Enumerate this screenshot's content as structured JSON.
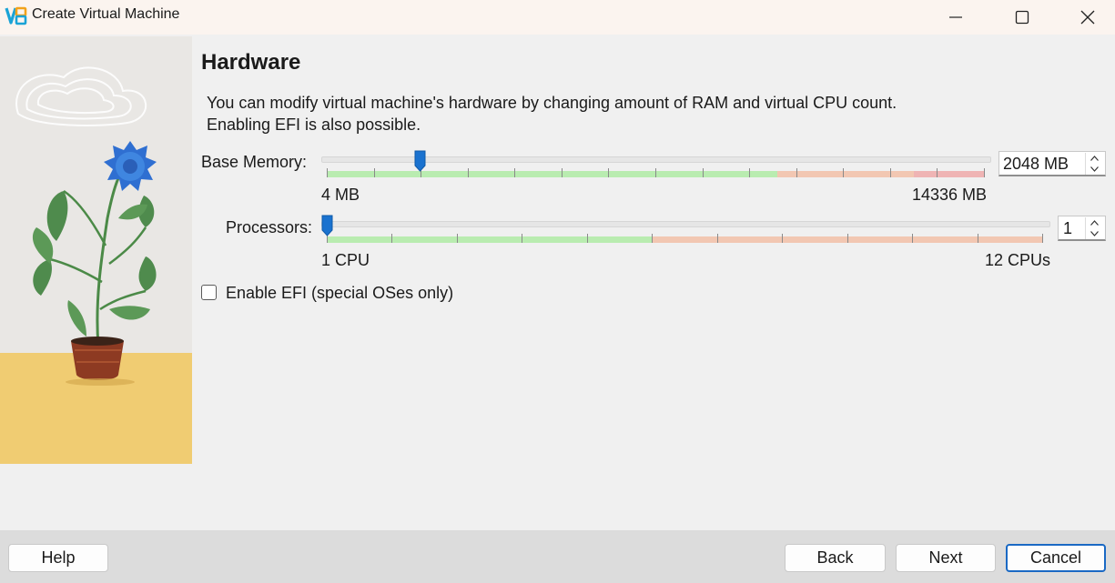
{
  "window": {
    "title": "Create Virtual Machine"
  },
  "page": {
    "heading": "Hardware",
    "description_line1": "You can modify virtual machine's hardware by changing amount of RAM and virtual CPU count.",
    "description_line2": "Enabling EFI is also possible."
  },
  "memory": {
    "label": "Base Memory:",
    "min_label": "4 MB",
    "max_label": "14336 MB",
    "min_value": 4,
    "max_value": 14336,
    "value": 2048,
    "value_text": "2048 MB",
    "recommended_max": 9830,
    "warning_max": 12800
  },
  "processors": {
    "label": "Processors:",
    "min_label": "1 CPU",
    "max_label": "12 CPUs",
    "min_value": 1,
    "max_value": 12,
    "value": 1,
    "value_text": "1",
    "recommended_max": 6
  },
  "efi": {
    "label": "Enable EFI (special OSes only)",
    "checked": false
  },
  "buttons": {
    "help": "Help",
    "back": "Back",
    "next": "Next",
    "cancel": "Cancel"
  },
  "colors": {
    "ok": "#b9ecb0",
    "warn": "#f2c7b2",
    "danger": "#efb4b4",
    "thumb": "#1a72cf",
    "accent": "#1a69c4"
  },
  "icons": {
    "app": "virtualbox-logo-icon",
    "minimize": "minimize-icon",
    "maximize": "maximize-icon",
    "close": "close-icon"
  }
}
